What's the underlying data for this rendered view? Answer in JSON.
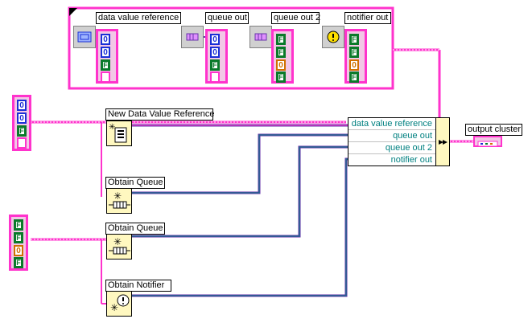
{
  "frame": {
    "labels": {
      "dvr": "data value reference",
      "queue_out": "queue out",
      "queue_out_2": "queue out 2",
      "notifier_out": "notifier out"
    }
  },
  "nodes": {
    "new_dvr": "New Data Value Reference",
    "obtain_queue_1": "Obtain Queue",
    "obtain_queue_2": "Obtain Queue",
    "obtain_notifier": "Obtain Notifier"
  },
  "bundle": {
    "rows": [
      "data value reference",
      "queue out",
      "queue out 2",
      "notifier out"
    ]
  },
  "output": {
    "label": "output cluster"
  },
  "terminal_values": {
    "num": "0",
    "bool": "F"
  },
  "colors": {
    "wire_pink": "#ff33cc",
    "wire_purple": "#6633aa",
    "wire_teal": "#008080",
    "numeric": "#1a2fd6",
    "boolean": "#0a7a2a",
    "i32": "#d07000"
  }
}
